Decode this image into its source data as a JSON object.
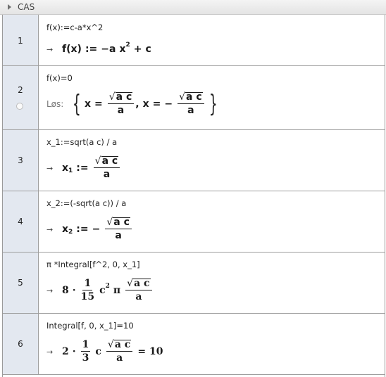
{
  "panel": {
    "title": "CAS"
  },
  "rows": [
    {
      "number": "1",
      "input": "f(x):=c-a*x^2",
      "output_prefix": "→"
    },
    {
      "number": "2",
      "input": "f(x)=0",
      "output_label": "Løs:"
    },
    {
      "number": "3",
      "input": "x_1:=sqrt(a c) / a",
      "output_prefix": "→"
    },
    {
      "number": "4",
      "input": "x_2:=(-sqrt(a c)) / a",
      "output_prefix": "→"
    },
    {
      "number": "5",
      "input": "π *Integral[f^2, 0, x_1]",
      "output_prefix": "→"
    },
    {
      "number": "6",
      "input": "Integral[f, 0, x_1]=10",
      "output_prefix": "→"
    }
  ],
  "math": {
    "f": "f",
    "x": "x",
    "a": "a",
    "c": "c",
    "ac": "a c",
    "assign": ":=",
    "eq": "=",
    "minus": "−",
    "plus": "+",
    "comma": ",",
    "cdot": "·",
    "pi": "π",
    "lparen": "(",
    "rparen": ")",
    "sqrt_sign": "√",
    "brace_l": "{",
    "brace_r": "}",
    "sub1": "1",
    "sub2": "2",
    "exp2": "2",
    "n8": "8",
    "n1": "1",
    "n15": "15",
    "n2": "2",
    "n3": "3",
    "n10": "10"
  }
}
